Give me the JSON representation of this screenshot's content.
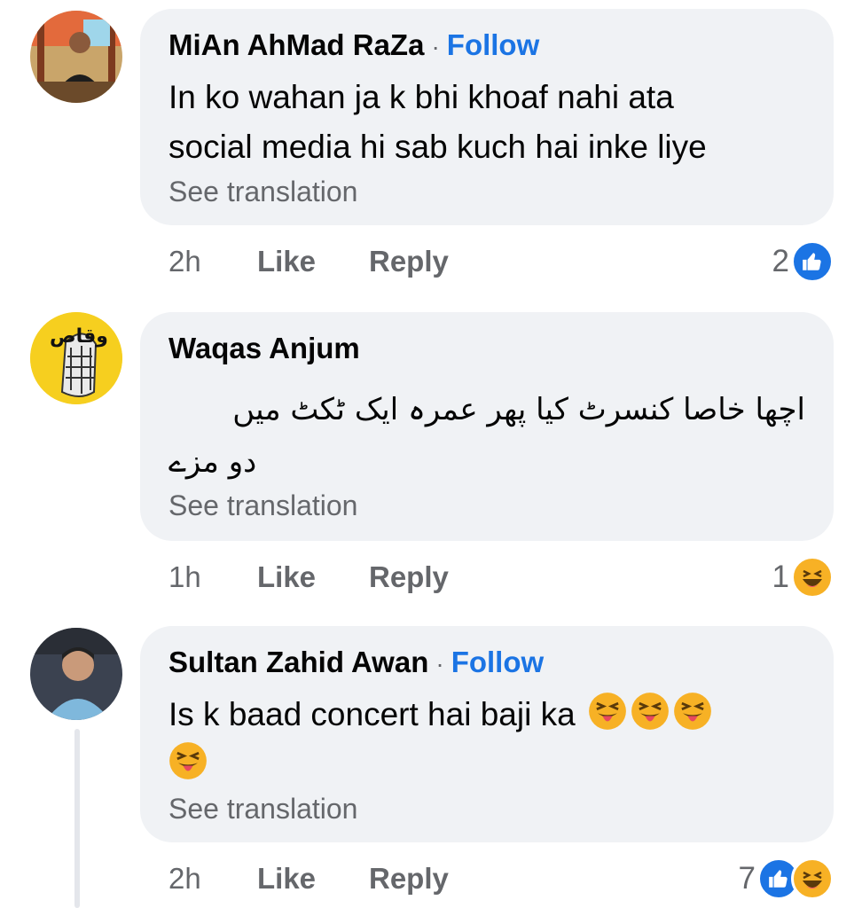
{
  "comments": [
    {
      "author": "MiAn AhMad RaZa",
      "follow": "Follow",
      "separator": "·",
      "text_lines": [
        "In ko wahan ja k bhi khoaf nahi ata",
        "social media hi sab kuch hai inke liye"
      ],
      "see_translation": "See translation",
      "time": "2h",
      "like": "Like",
      "reply": "Reply",
      "reaction_count": "2",
      "reactions": [
        "like-icon"
      ]
    },
    {
      "author": "Waqas Anjum",
      "text_lines": [
        "اچھا خاصا کنسرٹ کیا پھر عمرہ ایک ٹکٹ میں",
        "دو مزے"
      ],
      "see_translation": "See translation",
      "time": "1h",
      "like": "Like",
      "reply": "Reply",
      "reaction_count": "1",
      "reactions": [
        "haha-icon"
      ],
      "avatar_text": "وقاص"
    },
    {
      "author": "Sultan Zahid Awan",
      "follow": "Follow",
      "separator": "·",
      "text": "Is k baad concert hai baji ka",
      "see_translation": "See translation",
      "time": "2h",
      "like": "Like",
      "reply": "Reply",
      "reaction_count": "7",
      "reactions": [
        "like-icon",
        "haha-icon"
      ]
    }
  ],
  "colors": {
    "bubble": "#f0f2f5",
    "link": "#1b74e4",
    "secondary": "#65676b",
    "haha": "#f7b125"
  }
}
